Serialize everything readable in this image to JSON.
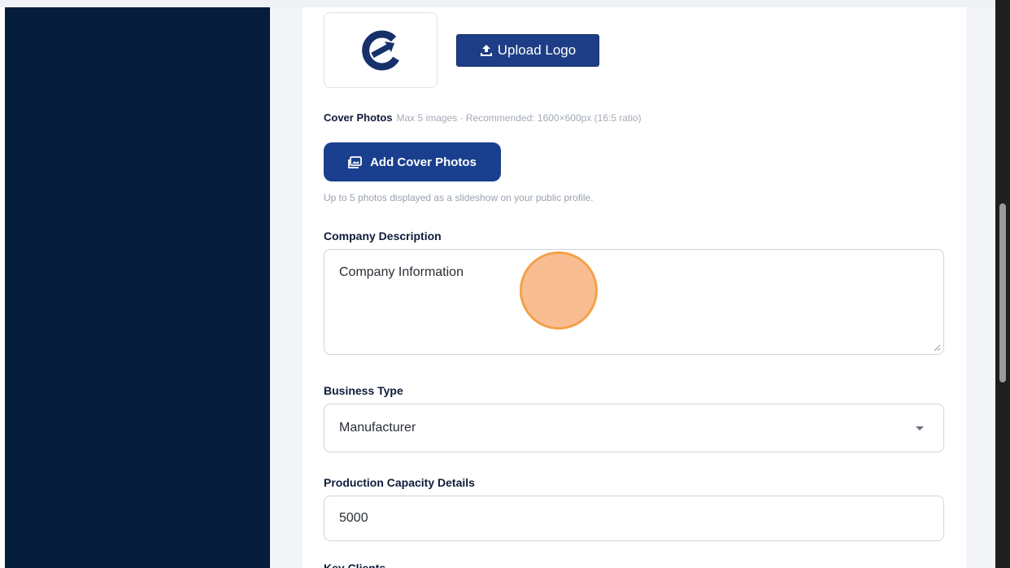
{
  "logo": {
    "upload_label": "Upload Logo"
  },
  "cover_photos": {
    "label": "Cover Photos",
    "hint": "Max 5 images · Recommended: 1600×600px (16:5 ratio)",
    "button_label": "Add Cover Photos",
    "help": "Up to 5 photos displayed as a slideshow on your public profile."
  },
  "company_description": {
    "label": "Company Description",
    "value": "Company Information"
  },
  "business_type": {
    "label": "Business Type",
    "selected": "Manufacturer"
  },
  "production_capacity": {
    "label": "Production Capacity Details",
    "value": "5000"
  },
  "next_section": {
    "label": "Key Clients"
  },
  "colors": {
    "sidebar": "#061c3d",
    "primary_button": "#1d3e86",
    "cursor_highlight": "#f8ba8c"
  },
  "icons": {
    "upload": "upload-icon",
    "photos": "photos-icon",
    "dropdown": "chevron-down-icon",
    "logo": "company-logo"
  }
}
